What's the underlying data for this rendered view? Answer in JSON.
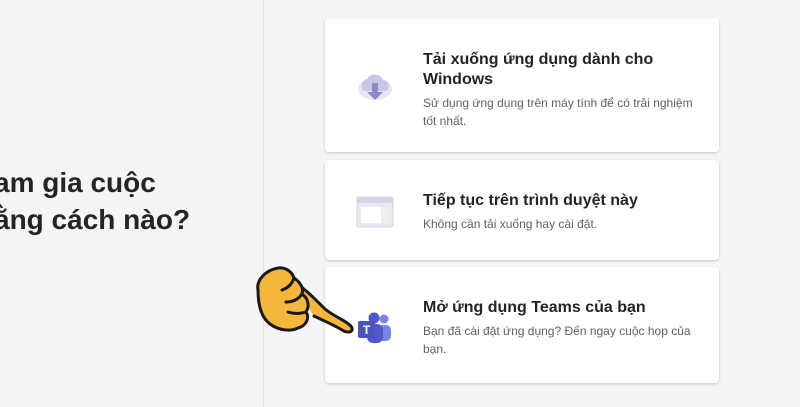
{
  "question": {
    "line1": "am gia cuộc",
    "line2": "ằng cách nào?"
  },
  "options": [
    {
      "title": "Tải xuống ứng dụng dành cho Windows",
      "description": "Sử dụng ứng dụng trên máy tính để có trải nghiệm tốt nhất.",
      "icon": "download-icon"
    },
    {
      "title": "Tiếp tục trên trình duyệt này",
      "description": "Không cần tải xuống hay cài đặt.",
      "icon": "browser-window-icon"
    },
    {
      "title": "Mở ứng dụng Teams của bạn",
      "description": "Bạn đã cài đặt ứng dụng? Đến ngay cuộc họp của bạn.",
      "icon": "teams-logo-icon"
    }
  ],
  "colors": {
    "accent": "#6264a7",
    "accent_light": "#c5c6e8",
    "background": "#f5f5f5",
    "card": "#ffffff",
    "hand_fill": "#f5b63c"
  }
}
